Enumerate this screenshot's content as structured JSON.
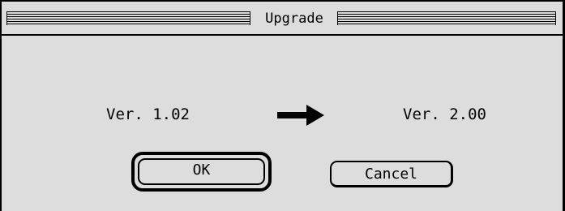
{
  "dialog": {
    "title": "Upgrade"
  },
  "versions": {
    "from": "Ver. 1.02",
    "to": "Ver. 2.00",
    "arrow_icon": "right-arrow-icon"
  },
  "buttons": {
    "ok_label": "OK",
    "cancel_label": "Cancel"
  },
  "colors": {
    "background": "#dddddd",
    "foreground": "#000000"
  }
}
